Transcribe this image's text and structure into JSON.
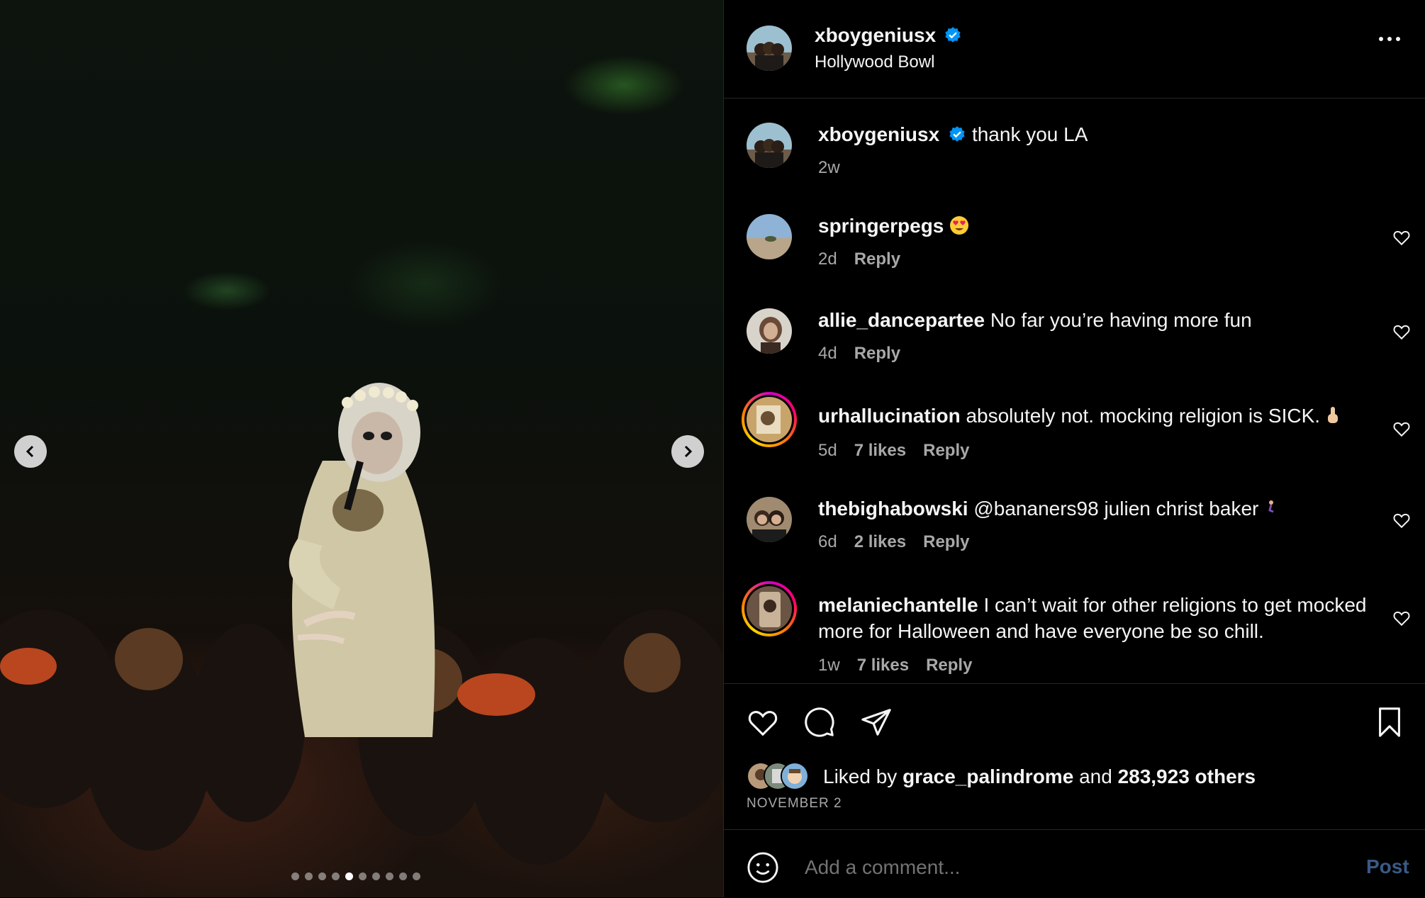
{
  "post": {
    "author": "xboygeniusx",
    "location": "Hollywood Bowl",
    "caption": "thank you LA",
    "caption_age": "2w",
    "carousel": {
      "total": 10,
      "active_index": 4
    }
  },
  "comments": [
    {
      "user": "springerpegs",
      "text": "",
      "emoji": "heart-eyes",
      "age": "2d",
      "likes": "",
      "reply": "Reply",
      "ring": false
    },
    {
      "user": "allie_dancepartee",
      "text": "No far you’re having more fun",
      "age": "4d",
      "likes": "",
      "reply": "Reply",
      "ring": false
    },
    {
      "user": "urhallucination",
      "text": "absolutely not. mocking religion is SICK.",
      "emoji": "raised-finger",
      "age": "5d",
      "likes": "7 likes",
      "reply": "Reply",
      "ring": true
    },
    {
      "user": "thebighabowski",
      "text": "@bananers98 julien christ baker",
      "emoji": "kneeling-figure",
      "age": "6d",
      "likes": "2 likes",
      "reply": "Reply",
      "ring": false
    },
    {
      "user": "melaniechantelle",
      "text": "I can’t wait for other religions to get mocked more for Halloween and have everyone be so chill.",
      "age": "1w",
      "likes": "7 likes",
      "reply": "Reply",
      "ring": true
    }
  ],
  "likes": {
    "prefix": "Liked by",
    "user": "grace_palindrome",
    "joiner": "and",
    "others": "283,923 others"
  },
  "date": "NOVEMBER 2",
  "composer": {
    "placeholder": "Add a comment...",
    "post_label": "Post"
  },
  "colors": {
    "verified": "#0095f6",
    "post_disabled": "#3a5a86",
    "secondary_text": "#a8a8a8"
  }
}
